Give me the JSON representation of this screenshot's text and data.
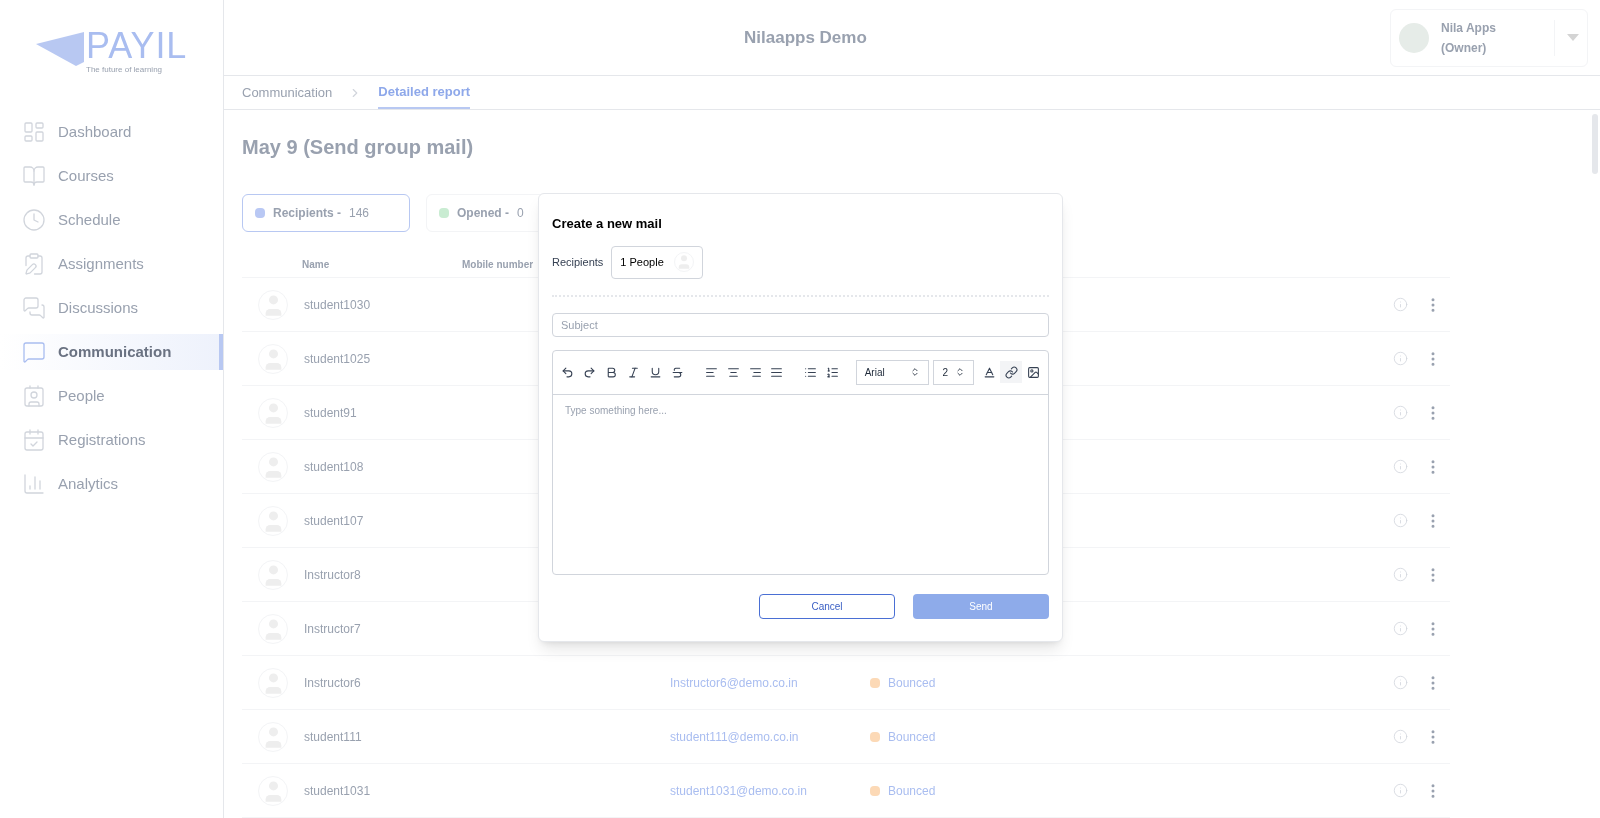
{
  "logo": {
    "name": "PAYIL",
    "tagline": "The future of learning"
  },
  "sidebar": {
    "items": [
      {
        "kind": "dashboard",
        "label": "Dashboard",
        "selected": false
      },
      {
        "kind": "courses",
        "label": "Courses",
        "selected": false
      },
      {
        "kind": "schedule",
        "label": "Schedule",
        "selected": false
      },
      {
        "kind": "assignments",
        "label": "Assignments",
        "selected": false
      },
      {
        "kind": "discussions",
        "label": "Discussions",
        "selected": false
      },
      {
        "kind": "communication",
        "label": "Communication",
        "selected": true
      },
      {
        "kind": "people",
        "label": "People",
        "selected": false
      },
      {
        "kind": "registrations",
        "label": "Registrations",
        "selected": false
      },
      {
        "kind": "analytics",
        "label": "Analytics",
        "selected": false
      }
    ]
  },
  "header": {
    "title": "Nilaapps Demo",
    "user": {
      "name": "Nila Apps",
      "role": "(Owner)"
    }
  },
  "breadcrumb": [
    {
      "label": "Communication",
      "selected": false
    },
    {
      "label": "Detailed report",
      "selected": true
    }
  ],
  "page_title": "May 9 (Send group mail)",
  "stat_cards": [
    {
      "label": "Recipients -",
      "count": "146",
      "color": "#b9c8f4",
      "selected": true
    },
    {
      "label": "Opened -",
      "count": "0",
      "color": "#c9ecd2",
      "selected": false
    }
  ],
  "table": {
    "columns": [
      "Name",
      "Mobile number"
    ],
    "rows": [
      {
        "name": "student1030"
      },
      {
        "name": "student1025"
      },
      {
        "name": "student91"
      },
      {
        "name": "student108"
      },
      {
        "name": "student107"
      },
      {
        "name": "Instructor8"
      },
      {
        "name": "Instructor7"
      },
      {
        "name": "Instructor6",
        "email": "Instructor6@demo.co.in",
        "status": "Bounced",
        "color": "#fcd9b6"
      },
      {
        "name": "student111",
        "email": "student111@demo.co.in",
        "status": "Bounced",
        "color": "#fcd9b6"
      },
      {
        "name": "student1031",
        "email": "student1031@demo.co.in",
        "status": "Bounced",
        "color": "#fcd9b6"
      }
    ]
  },
  "dialog": {
    "title": "Create a new mail",
    "recipients_label": "Recipients",
    "recipients_value": "1 People",
    "subject": {
      "placeholder": "Subject"
    },
    "toolbar": [
      {
        "kind": "undo",
        "active": false
      },
      {
        "kind": "redo",
        "active": false
      },
      {
        "kind": "bold",
        "active": false
      },
      {
        "kind": "italic",
        "active": false
      },
      {
        "kind": "underline",
        "active": false
      },
      {
        "kind": "strike",
        "active": false
      },
      {
        "kind": "align-left",
        "active": false
      },
      {
        "kind": "align-center",
        "active": false
      },
      {
        "kind": "align-right",
        "active": false
      },
      {
        "kind": "justify",
        "active": false
      },
      {
        "kind": "bullets",
        "active": false
      },
      {
        "kind": "numbers",
        "active": false
      },
      {
        "kind": "font",
        "value": "Arial"
      },
      {
        "kind": "size",
        "value": "2"
      },
      {
        "kind": "text-color",
        "active": false
      },
      {
        "kind": "link",
        "active": true
      },
      {
        "kind": "image",
        "active": false
      }
    ],
    "body": {
      "placeholder": "Type something here..."
    },
    "buttons": [
      {
        "kind": "secondary",
        "label": "Cancel"
      },
      {
        "kind": "primary",
        "label": "Send"
      }
    ]
  }
}
